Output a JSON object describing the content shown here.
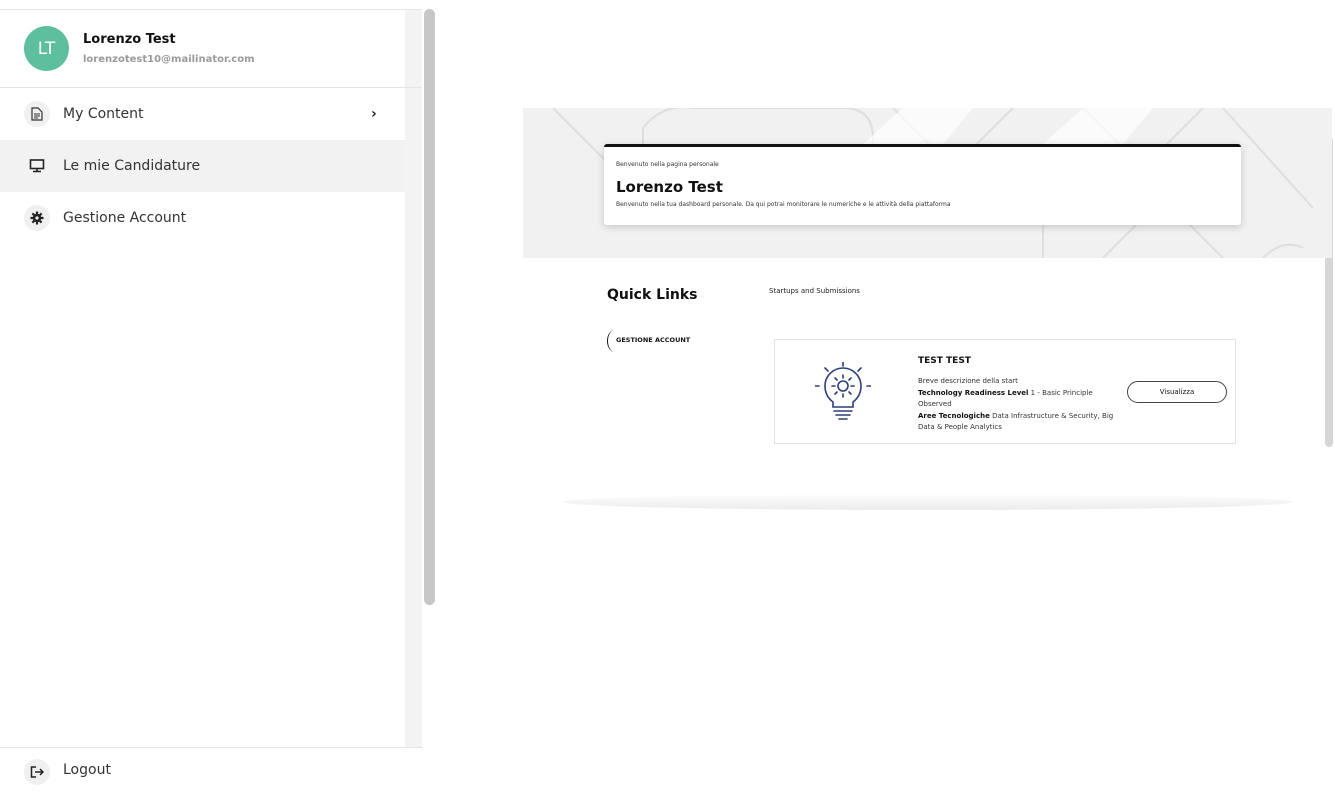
{
  "user": {
    "initials": "LT",
    "name": "Lorenzo Test",
    "email": "lorenzotest10@mailinator.com",
    "avatar_color": "#5dbf9d"
  },
  "sidebar": {
    "items": [
      {
        "label": "My Content",
        "icon": "document-icon",
        "has_chevron": true,
        "chevron": "›"
      },
      {
        "label": "Le mie Candidature",
        "icon": "monitor-icon",
        "active": true
      },
      {
        "label": "Gestione Account",
        "icon": "gear-icon"
      }
    ],
    "logout": {
      "label": "Logout",
      "icon": "logout-icon"
    }
  },
  "hero": {
    "subtitle": "Benvenuto nella pagina personale",
    "title": "Lorenzo Test",
    "description": "Benvenuto nella tua dashboard personale. Da qui potrai monitorare le numeriche e le attività della piattaforma"
  },
  "quick_links": {
    "title": "Quick Links",
    "items": [
      {
        "label": "GESTIONE ACCOUNT"
      }
    ]
  },
  "startups": {
    "title": "Startups and Submissions",
    "cards": [
      {
        "name": "TEST TEST",
        "short_description": "Breve descrizione della start",
        "trl_label": "Technology Readiness Level",
        "trl_value": "1 - Basic Principle Observed",
        "areas_label": "Aree Tecnologiche",
        "areas_value": "Data Infrastructure & Security, Big Data & People Analytics",
        "icon": "lightbulb-gear-icon",
        "button_label": "Visualizza"
      }
    ]
  }
}
